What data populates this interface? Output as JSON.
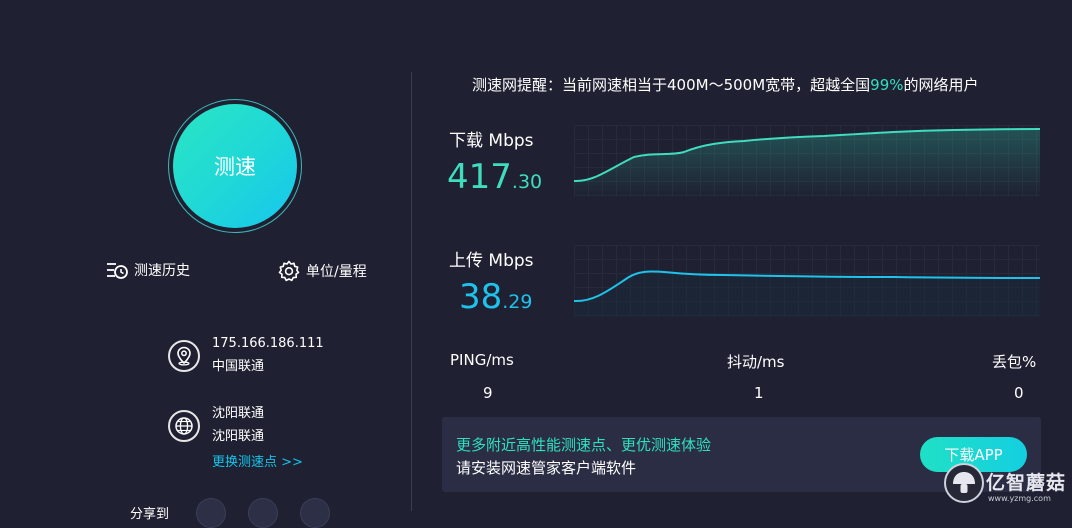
{
  "speed_button": {
    "label": "测速"
  },
  "tools": {
    "history_label": "测速历史",
    "units_label": "单位/量程"
  },
  "connection": {
    "ip": "175.166.186.111",
    "isp": "中国联通",
    "server_line1": "沈阳联通",
    "server_line2": "沈阳联通",
    "change_node_link": "更换测速点 >>"
  },
  "share": {
    "label": "分享到"
  },
  "notice": {
    "prefix": "测速网提醒：当前网速相当于400M～500M宽带，超越全国",
    "percent": "99%",
    "suffix": "的网络用户"
  },
  "download": {
    "label": "下载 Mbps",
    "int": "417",
    "dec": ".30",
    "color": "#3fdcbd"
  },
  "upload": {
    "label": "上传 Mbps",
    "int": "38",
    "dec": ".29",
    "color": "#1ec2ea"
  },
  "stats": {
    "ping_label": "PING/ms",
    "ping_value": "9",
    "jitter_label": "抖动/ms",
    "jitter_value": "1",
    "loss_label": "丢包%",
    "loss_value": "0"
  },
  "banner": {
    "line1": "更多附近高性能测速点、更优测速体验",
    "line2": "请安装网速管家客户端软件",
    "button": "下载APP"
  },
  "watermark": {
    "text": "亿智蘑菇",
    "url": "www.yzmg.com"
  }
}
